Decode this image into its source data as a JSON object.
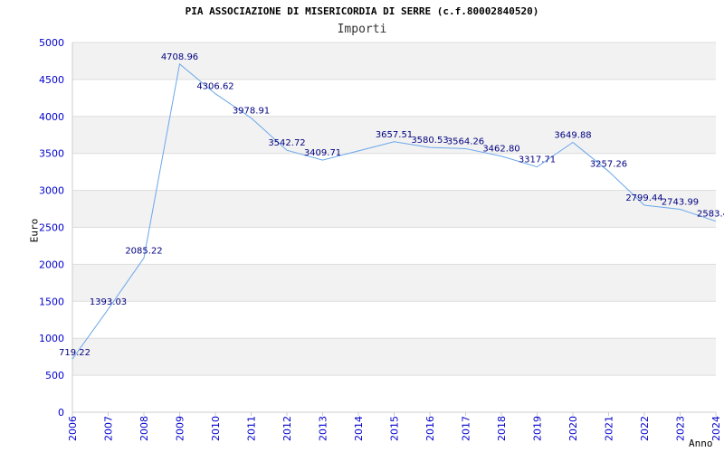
{
  "chart_data": {
    "type": "line",
    "title": "PIA ASSOCIAZIONE DI MISERICORDIA DI SERRE (c.f.80002840520)",
    "subtitle": "Importi",
    "xlabel": "Anno",
    "ylabel": "Euro",
    "ylim": [
      0,
      5000
    ],
    "yticks": [
      0,
      500,
      1000,
      1500,
      2000,
      2500,
      3000,
      3500,
      4000,
      4500,
      5000
    ],
    "grid": true,
    "categories": [
      "2006",
      "2007",
      "2008",
      "2009",
      "2010",
      "2011",
      "2012",
      "2013",
      "2014",
      "2015",
      "2016",
      "2017",
      "2018",
      "2019",
      "2020",
      "2021",
      "2022",
      "2023",
      "2024"
    ],
    "points": [
      {
        "x": "2006",
        "y": 719.22,
        "label": "719.22"
      },
      {
        "x": "2007",
        "y": 1393.03,
        "label": "1393.03"
      },
      {
        "x": "2008",
        "y": 2085.22,
        "label": "2085.22"
      },
      {
        "x": "2009",
        "y": 4708.96,
        "label": "4708.96"
      },
      {
        "x": "2010",
        "y": 4306.62,
        "label": "4306.62"
      },
      {
        "x": "2011",
        "y": 3978.91,
        "label": "3978.91"
      },
      {
        "x": "2012",
        "y": 3542.72,
        "label": "3542.72"
      },
      {
        "x": "2013",
        "y": 3409.71,
        "label": "3409.71"
      },
      {
        "x": "2015",
        "y": 3657.51,
        "label": "3657.51"
      },
      {
        "x": "2016",
        "y": 3580.53,
        "label": "3580.53"
      },
      {
        "x": "2017",
        "y": 3564.26,
        "label": "3564.26"
      },
      {
        "x": "2018",
        "y": 3462.8,
        "label": "3462.80"
      },
      {
        "x": "2019",
        "y": 3317.71,
        "label": "3317.71"
      },
      {
        "x": "2020",
        "y": 3649.88,
        "label": "3649.88"
      },
      {
        "x": "2021",
        "y": 3257.26,
        "label": "3257.26"
      },
      {
        "x": "2022",
        "y": 2799.44,
        "label": "2799.44"
      },
      {
        "x": "2023",
        "y": 2743.99,
        "label": "2743.99"
      },
      {
        "x": "2024",
        "y": 2583.4,
        "label": "2583.4"
      }
    ],
    "colors": {
      "line": "#6aa7ea",
      "tick_text": "#0000cc",
      "data_label": "#000080",
      "band": "#f2f2f2",
      "grid": "#dddddd",
      "axis": "#cccccc"
    }
  }
}
